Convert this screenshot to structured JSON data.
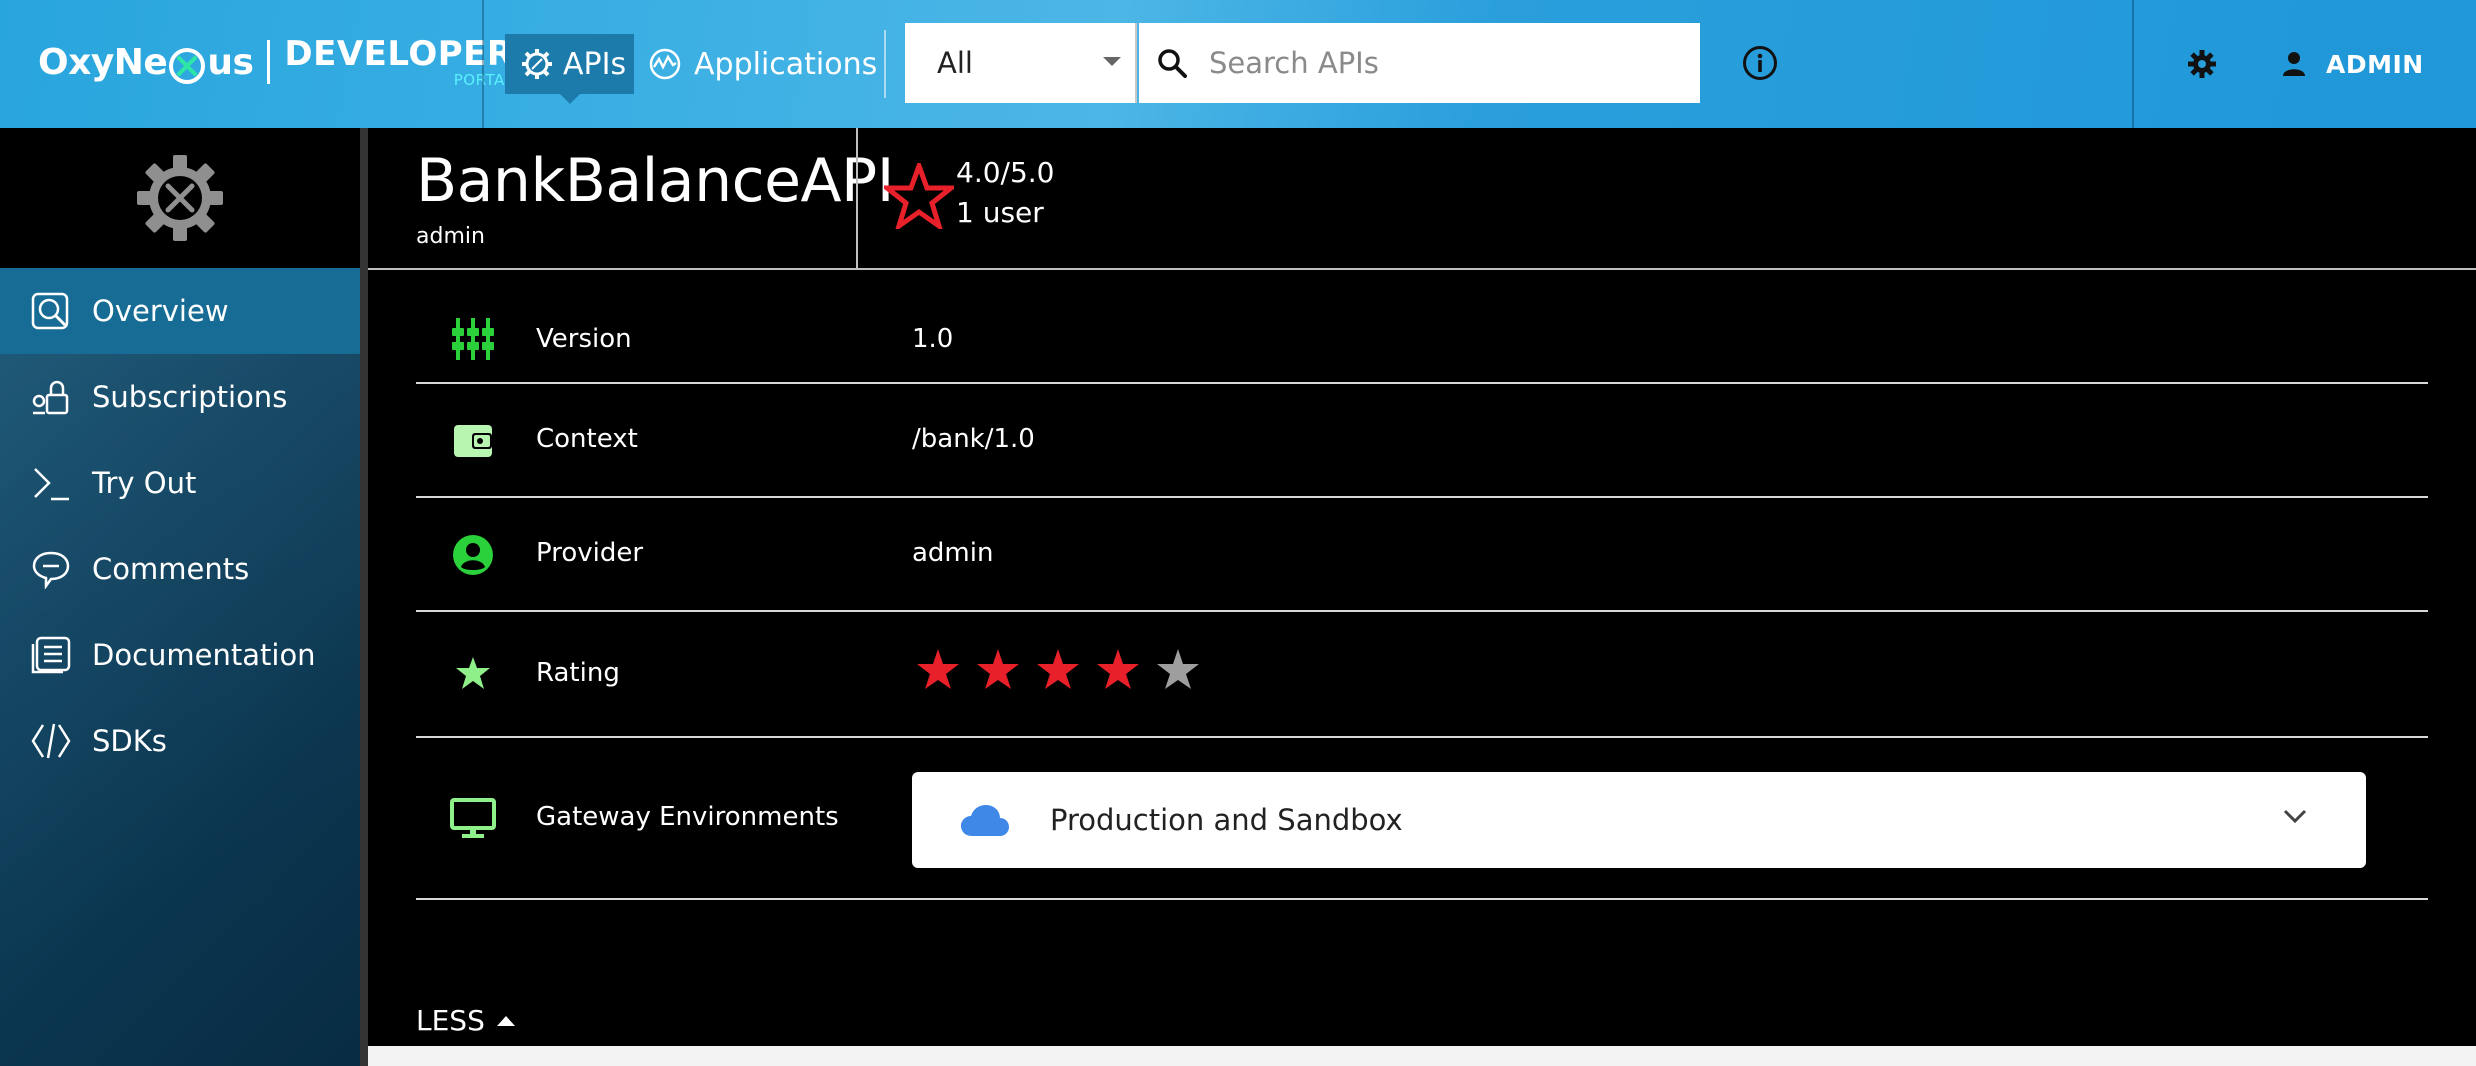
{
  "header": {
    "logo_text_left": "OxyNe",
    "logo_text_right": "us",
    "portal_title": "DEVELOPER",
    "portal_subtitle": "PORTAL",
    "nav": {
      "apis_label": "APIs",
      "applications_label": "Applications"
    },
    "filter_value": "All",
    "search_placeholder": "Search APIs",
    "user_label": "ADMIN"
  },
  "sidebar": {
    "items": [
      {
        "label": "Overview",
        "icon": "overview-icon",
        "active": true
      },
      {
        "label": "Subscriptions",
        "icon": "subscriptions-icon"
      },
      {
        "label": "Try Out",
        "icon": "terminal-icon"
      },
      {
        "label": "Comments",
        "icon": "comments-icon"
      },
      {
        "label": "Documentation",
        "icon": "documentation-icon"
      },
      {
        "label": "SDKs",
        "icon": "code-icon"
      }
    ]
  },
  "api": {
    "name": "BankBalanceAPI",
    "owner": "admin",
    "rating_text": "4.0/5.0",
    "rating_users": "1 user"
  },
  "details": {
    "version_label": "Version",
    "version_value": "1.0",
    "context_label": "Context",
    "context_value": "/bank/1.0",
    "provider_label": "Provider",
    "provider_value": "admin",
    "rating_label": "Rating",
    "rating_stars": 4,
    "rating_max": 5,
    "gateway_label": "Gateway Environments",
    "gateway_value": "Production and Sandbox"
  },
  "less_label": "LESS",
  "colors": {
    "accent": "#29a5dd",
    "sidebar_active": "#176c95",
    "star_red": "#e8202a",
    "star_grey": "#9e9e9e",
    "icon_green": "#2ad13a",
    "cloud_blue": "#3f88e8"
  }
}
